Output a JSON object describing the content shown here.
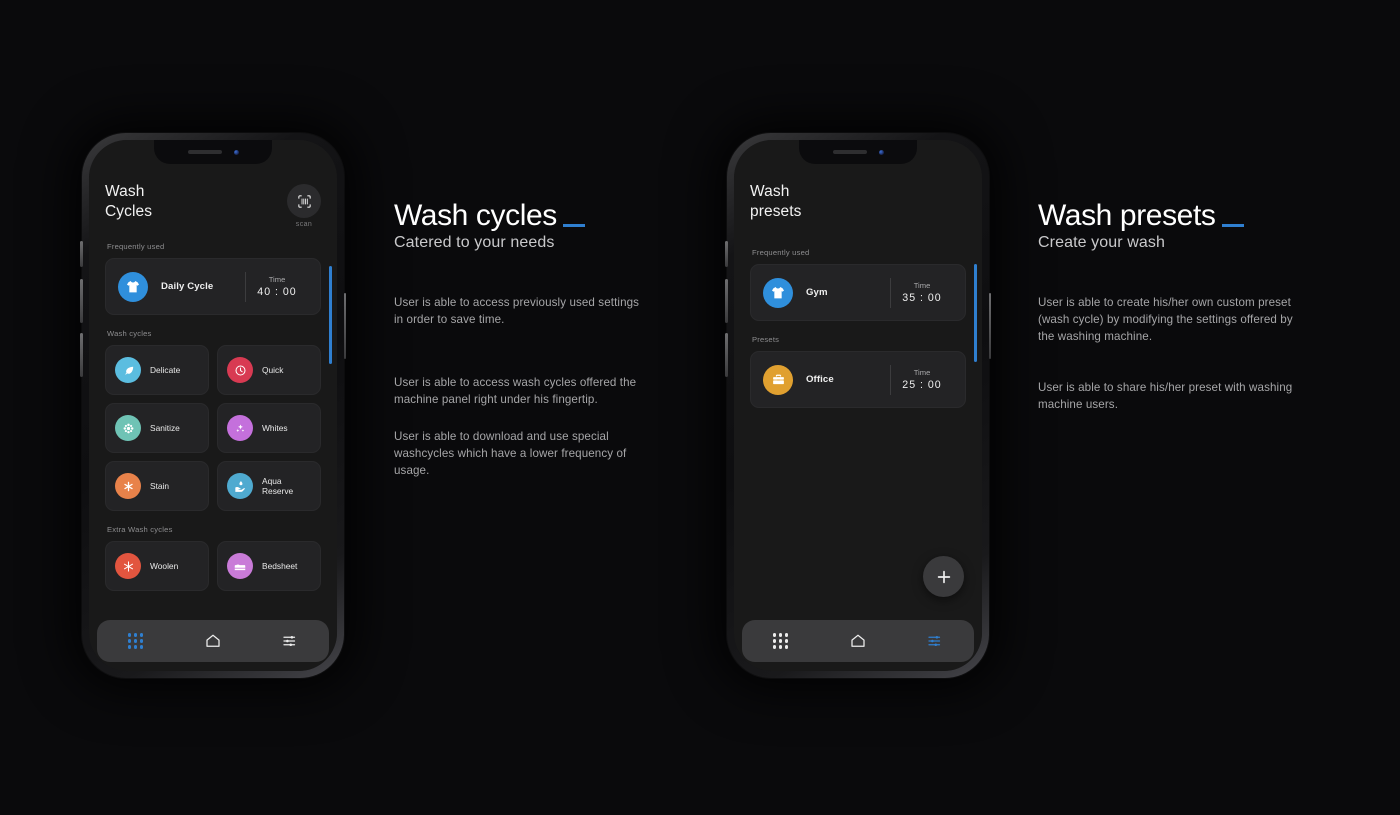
{
  "theme": {
    "bg": "#0a0a0c",
    "accent": "#2f7fd0",
    "card_bg": "#232325",
    "nav_bg": "#3a3a3c"
  },
  "phone_left": {
    "app_title_line1": "Wash",
    "app_title_line2": "Cycles",
    "scan_label": "scan",
    "sections": [
      {
        "label": "Frequently used"
      },
      {
        "label": "Wash cycles"
      },
      {
        "label": "Extra Wash cycles"
      }
    ],
    "frequently_used": [
      {
        "name": "Daily Cycle",
        "icon": "tshirt-icon",
        "color": "#2f8fdc",
        "time_label": "Time",
        "time_value": "40 : 00"
      }
    ],
    "wash_cycles": [
      {
        "name": "Delicate",
        "icon": "feather-icon",
        "color": "#5bbde0"
      },
      {
        "name": "Quick",
        "icon": "clock-icon",
        "color": "#d83a52"
      },
      {
        "name": "Sanitize",
        "icon": "flower-icon",
        "color": "#6fc3b5"
      },
      {
        "name": "Whites",
        "icon": "sparkles-icon",
        "color": "#c470dc"
      },
      {
        "name": "Stain",
        "icon": "asterisk-icon",
        "color": "#e8824a"
      },
      {
        "name": "Aqua Reserve",
        "icon": "hand-drop-icon",
        "color": "#4faad0"
      }
    ],
    "extra_wash_cycles": [
      {
        "name": "Woolen",
        "icon": "snowflake-icon",
        "color": "#e2553f"
      },
      {
        "name": "Bedsheet",
        "icon": "bed-icon",
        "color": "#c97bd8"
      }
    ],
    "nav": [
      {
        "name": "apps-grid-icon",
        "label": "Apps",
        "active": true
      },
      {
        "name": "home-icon",
        "label": "Home",
        "active": false
      },
      {
        "name": "sliders-icon",
        "label": "Settings",
        "active": false
      }
    ]
  },
  "phone_right": {
    "app_title_line1": "Wash",
    "app_title_line2": "presets",
    "sections": [
      {
        "label": "Frequently used"
      },
      {
        "label": "Presets"
      }
    ],
    "frequently_used": [
      {
        "name": "Gym",
        "icon": "tshirt-icon",
        "color": "#2f8fdc",
        "time_label": "Time",
        "time_value": "35 : 00"
      }
    ],
    "presets": [
      {
        "name": "Office",
        "icon": "briefcase-icon",
        "color": "#e0a030",
        "time_label": "Time",
        "time_value": "25 : 00"
      }
    ],
    "fab": {
      "name": "add-preset-button",
      "glyph": "+"
    },
    "nav": [
      {
        "name": "apps-grid-icon",
        "label": "Apps",
        "active": false
      },
      {
        "name": "home-icon",
        "label": "Home",
        "active": false
      },
      {
        "name": "sliders-icon",
        "label": "Settings",
        "active": true
      }
    ]
  },
  "text_left": {
    "title": "Wash cycles",
    "subtitle": "Catered to your needs",
    "paragraphs": [
      "User is able to access previously used settings in order to save time.",
      "User is able to access wash cycles offered the machine panel right under his fingertip.",
      "User is able to download and use special washcycles which have a lower frequency of usage."
    ]
  },
  "text_right": {
    "title": "Wash presets",
    "subtitle": "Create your wash",
    "paragraphs": [
      "User is able to create his/her own custom preset (wash cycle) by modifying the settings offered by the washing machine.",
      "User is able to share his/her preset with washing machine users."
    ]
  }
}
